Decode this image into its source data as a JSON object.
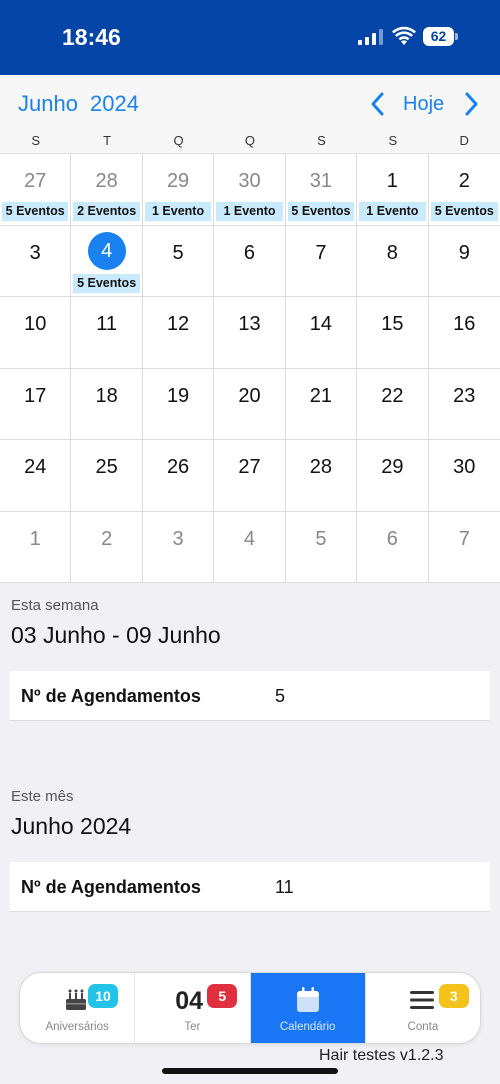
{
  "status_bar": {
    "time": "18:46",
    "battery": "62"
  },
  "calendar": {
    "month_title": "Junho  2024",
    "today_label": "Hoje",
    "weekdays": [
      "S",
      "T",
      "Q",
      "Q",
      "S",
      "S",
      "D"
    ],
    "weeks": [
      [
        {
          "day": "27",
          "other": true,
          "event": "5 Eventos"
        },
        {
          "day": "28",
          "other": true,
          "event": "2 Eventos"
        },
        {
          "day": "29",
          "other": true,
          "event": "1 Evento"
        },
        {
          "day": "30",
          "other": true,
          "event": "1 Evento"
        },
        {
          "day": "31",
          "other": true,
          "event": "5 Eventos"
        },
        {
          "day": "1",
          "event": "1 Evento"
        },
        {
          "day": "2",
          "event": "5 Eventos"
        }
      ],
      [
        {
          "day": "3"
        },
        {
          "day": "4",
          "today": true,
          "event": "5 Eventos"
        },
        {
          "day": "5"
        },
        {
          "day": "6"
        },
        {
          "day": "7"
        },
        {
          "day": "8"
        },
        {
          "day": "9"
        }
      ],
      [
        {
          "day": "10"
        },
        {
          "day": "11"
        },
        {
          "day": "12"
        },
        {
          "day": "13"
        },
        {
          "day": "14"
        },
        {
          "day": "15"
        },
        {
          "day": "16"
        }
      ],
      [
        {
          "day": "17"
        },
        {
          "day": "18"
        },
        {
          "day": "19"
        },
        {
          "day": "20"
        },
        {
          "day": "21"
        },
        {
          "day": "22"
        },
        {
          "day": "23"
        }
      ],
      [
        {
          "day": "24"
        },
        {
          "day": "25"
        },
        {
          "day": "26"
        },
        {
          "day": "27"
        },
        {
          "day": "28"
        },
        {
          "day": "29"
        },
        {
          "day": "30"
        }
      ],
      [
        {
          "day": "1",
          "other": true
        },
        {
          "day": "2",
          "other": true
        },
        {
          "day": "3",
          "other": true
        },
        {
          "day": "4",
          "other": true
        },
        {
          "day": "5",
          "other": true
        },
        {
          "day": "6",
          "other": true
        },
        {
          "day": "7",
          "other": true
        }
      ]
    ]
  },
  "week_summary": {
    "label": "Esta semana",
    "range": "03 Junho - 09 Junho",
    "stat_label": "Nº de Agendamentos",
    "stat_value": "5"
  },
  "month_summary": {
    "label": "Este mês",
    "range": "Junho 2024",
    "stat_label": "Nº de Agendamentos",
    "stat_value": "11"
  },
  "tabbar": {
    "tabs": [
      {
        "label": "Aniversários",
        "badge": "10",
        "icon": "birthday-cake-icon"
      },
      {
        "label": "Ter",
        "badge": "5",
        "day": "04",
        "icon": "day-number"
      },
      {
        "label": "Calendário",
        "icon": "calendar-icon",
        "active": true
      },
      {
        "label": "Conta",
        "badge": "3",
        "icon": "menu-icon"
      }
    ]
  },
  "colors": {
    "accent": "#1a82f0",
    "status_bar": "#0645a8",
    "event_bg": "#c9eafc",
    "badge_cyan": "#22c3e6",
    "badge_red": "#e0303f",
    "badge_yellow": "#f3c21b"
  },
  "version": "Hair testes v1.2.3"
}
